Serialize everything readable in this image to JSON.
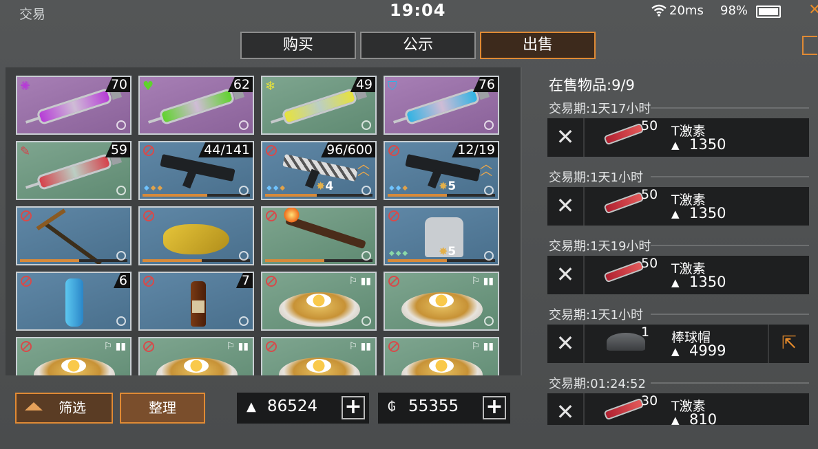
{
  "status": {
    "app_title": "交易",
    "time": "19:04",
    "ping": "20ms",
    "battery": "98%"
  },
  "tabs": [
    {
      "label": "购买",
      "active": false
    },
    {
      "label": "公示",
      "active": false
    },
    {
      "label": "出售",
      "active": true
    }
  ],
  "inventory": {
    "cells": [
      {
        "type": "syringe",
        "color": "#b63cd6",
        "bg": "purple",
        "badge": "virus-icon",
        "count": "70"
      },
      {
        "type": "syringe",
        "color": "#5fd32c",
        "bg": "purple",
        "badge": "heart-plus-icon",
        "count": "62"
      },
      {
        "type": "syringe",
        "color": "#e7e23b",
        "bg": "green",
        "badge": "snowflake-icon",
        "count": "49"
      },
      {
        "type": "syringe",
        "color": "#2fb3e3",
        "bg": "purple",
        "badge": "shield-icon",
        "count": "76"
      },
      {
        "type": "syringe",
        "color": "#d6404a",
        "bg": "green",
        "badge": "syringe-icon",
        "count": "59"
      },
      {
        "type": "rifle",
        "bg": "blue",
        "count": "44/141",
        "stars": ""
      },
      {
        "type": "rifle-camo",
        "bg": "blue",
        "count": "96/600",
        "stars": "4"
      },
      {
        "type": "rifle-dark",
        "bg": "blue",
        "count": "12/19",
        "stars": "5"
      },
      {
        "type": "pickaxe",
        "bg": "blue"
      },
      {
        "type": "chainsaw",
        "bg": "blue"
      },
      {
        "type": "torch",
        "bg": "green"
      },
      {
        "type": "jacket",
        "bg": "blue",
        "stars": "5"
      },
      {
        "type": "bottle-blue",
        "bg": "blue",
        "count": "6"
      },
      {
        "type": "bottle-brown",
        "bg": "blue",
        "count": "7"
      },
      {
        "type": "food",
        "bg": "green"
      },
      {
        "type": "food",
        "bg": "green"
      },
      {
        "type": "food",
        "bg": "green"
      },
      {
        "type": "food",
        "bg": "green"
      },
      {
        "type": "food",
        "bg": "green"
      },
      {
        "type": "food",
        "bg": "green"
      }
    ]
  },
  "controls": {
    "filter_label": "筛选",
    "sort_label": "整理"
  },
  "currency": {
    "gold": "86524",
    "coins": "55355"
  },
  "sell_panel": {
    "count_label": "在售物品:9/9",
    "listings": [
      {
        "period": "交易期:1天17小时",
        "qty": "50",
        "name": "T激素",
        "price": "1350",
        "item": "syringe"
      },
      {
        "period": "交易期:1天1小时",
        "qty": "50",
        "name": "T激素",
        "price": "1350",
        "item": "syringe"
      },
      {
        "period": "交易期:1天19小时",
        "qty": "50",
        "name": "T激素",
        "price": "1350",
        "item": "syringe"
      },
      {
        "period": "交易期:1天1小时",
        "qty": "1",
        "name": "棒球帽",
        "price": "4999",
        "item": "cap"
      },
      {
        "period": "交易期:01:24:52",
        "qty": "30",
        "name": "T激素",
        "price": "810",
        "item": "syringe"
      }
    ]
  }
}
